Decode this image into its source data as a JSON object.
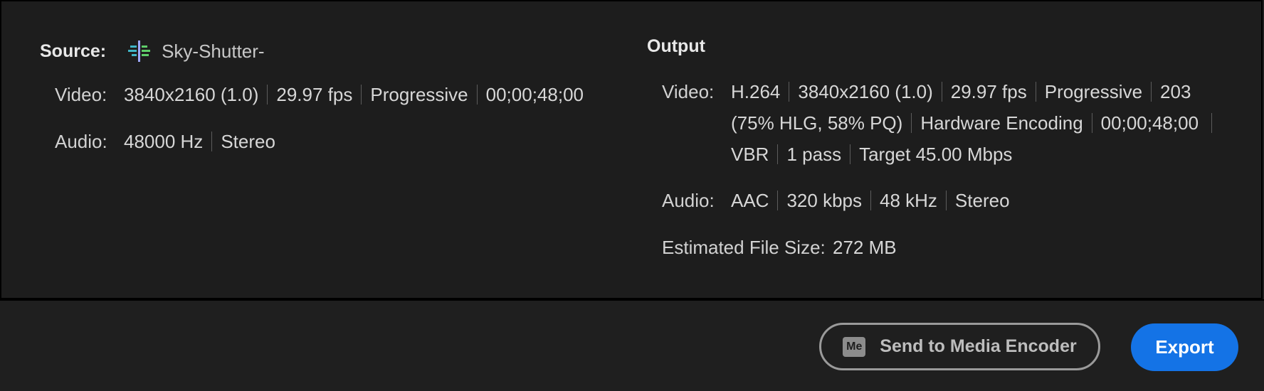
{
  "source": {
    "label": "Source:",
    "icon": "sequence-icon",
    "name": "Sky-Shutter-",
    "video": {
      "key": "Video:",
      "values": [
        "3840x2160 (1.0)",
        "29.97 fps",
        "Progressive",
        "00;00;48;00"
      ]
    },
    "audio": {
      "key": "Audio:",
      "values": [
        "48000 Hz",
        "Stereo"
      ]
    }
  },
  "output": {
    "label": "Output",
    "video": {
      "key": "Video:",
      "line1": [
        "H.264",
        "3840x2160 (1.0)",
        "29.97 fps",
        "Progressive",
        "203"
      ],
      "line2": [
        "(75% HLG, 58% PQ)",
        "Hardware Encoding",
        "00;00;48;00"
      ],
      "line3": [
        "VBR",
        "1 pass",
        "Target 45.00 Mbps"
      ]
    },
    "audio": {
      "key": "Audio:",
      "values": [
        "AAC",
        "320 kbps",
        "48 kHz",
        "Stereo"
      ]
    },
    "estimated_size": {
      "key": "Estimated File Size:",
      "value": "272 MB"
    }
  },
  "buttons": {
    "send_icon_text": "Me",
    "send_label": "Send to Media Encoder",
    "export_label": "Export"
  },
  "colors": {
    "background": "#1e1e1e",
    "export_accent": "#1473e6",
    "icon_teal": "#3fb5c6",
    "icon_green": "#5fce6a"
  }
}
